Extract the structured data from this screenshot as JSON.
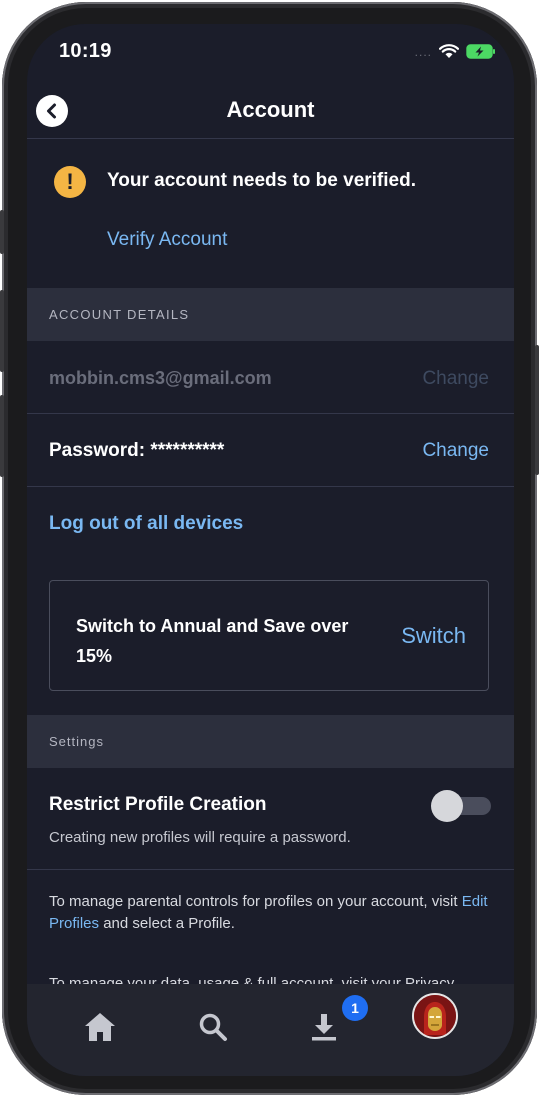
{
  "status": {
    "time": "10:19",
    "dots": "....",
    "wifi_icon": "wifi-icon",
    "battery_icon": "battery-charging-icon"
  },
  "header": {
    "title": "Account",
    "back_icon": "chevron-left-icon"
  },
  "verification": {
    "icon": "warning-icon",
    "mark": "!",
    "message": "Your account needs to be verified.",
    "link": "Verify Account"
  },
  "account_details": {
    "section_title": "ACCOUNT DETAILS",
    "email": "mobbin.cms3@gmail.com",
    "email_change": "Change",
    "password_label": "Password: **********",
    "password_change": "Change",
    "logout": "Log out of all devices"
  },
  "promo": {
    "text": "Switch to Annual and Save over 15%",
    "action": "Switch"
  },
  "settings": {
    "section_title": "Settings",
    "restrict_title": "Restrict Profile Creation",
    "restrict_description": "Creating new profiles will require a password.",
    "restrict_enabled": false,
    "parental_prefix": "To manage parental controls for profiles on your account, visit ",
    "parental_link": "Edit Profiles",
    "parental_suffix": " and select a Profile.",
    "cutoff_text": "To manage your data, usage & full account, visit your Privacy"
  },
  "tabbar": {
    "tabs": [
      {
        "name": "home",
        "icon": "home-icon"
      },
      {
        "name": "search",
        "icon": "search-icon"
      },
      {
        "name": "downloads",
        "icon": "download-icon",
        "badge": "1"
      },
      {
        "name": "profile",
        "icon": "avatar"
      }
    ]
  },
  "colors": {
    "background": "#1b1d2a",
    "section": "#2c2f3d",
    "link": "#7ab8f2",
    "warning": "#f4b544",
    "badge": "#1f6ef2"
  }
}
